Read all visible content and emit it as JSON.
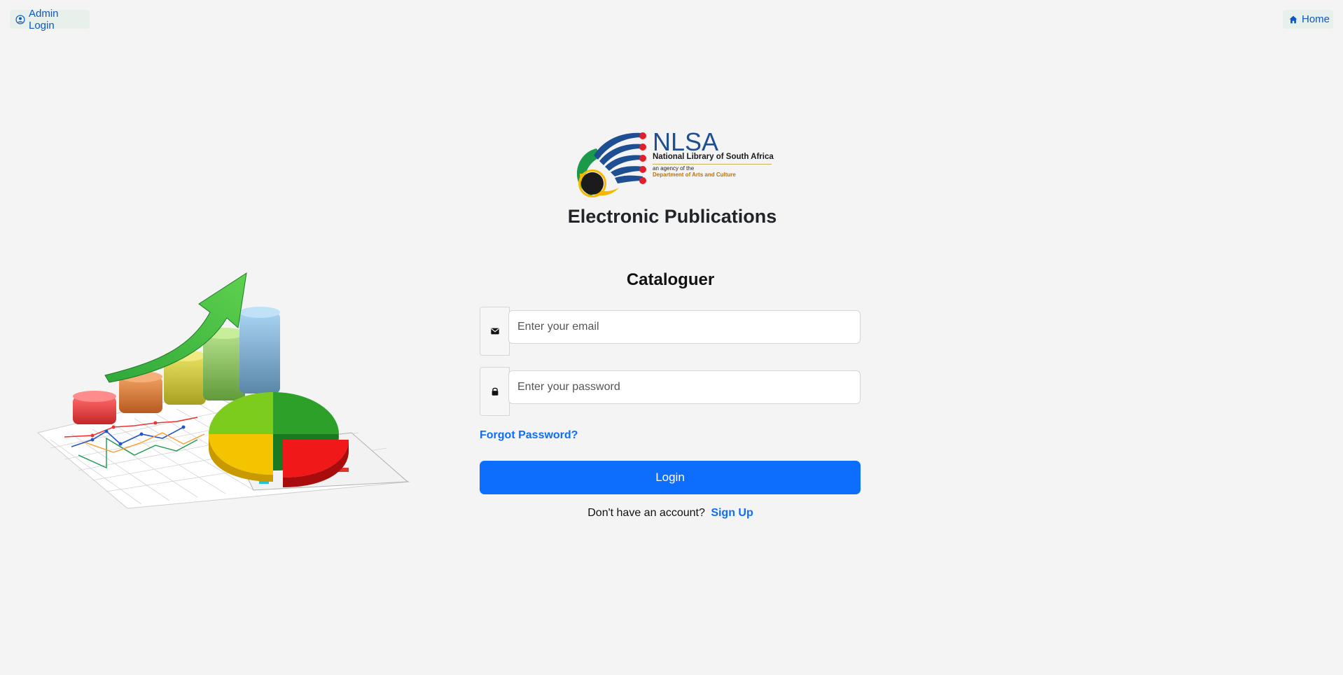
{
  "topbar": {
    "admin_login_label": "Admin Login",
    "home_label": "Home"
  },
  "logo": {
    "acronym": "NLSA",
    "full_name": "National Library of South Africa",
    "agency_line": "an agency of the",
    "department": "Department of Arts and Culture"
  },
  "app_title": "Electronic Publications",
  "form": {
    "title": "Cataloguer",
    "email_placeholder": "Enter your email",
    "email_value": "",
    "password_placeholder": "Enter your password",
    "password_value": "",
    "forgot_label": "Forgot Password?",
    "login_label": "Login",
    "no_account_text": "Don't have an account?",
    "signup_label": "Sign Up"
  },
  "icons": {
    "admin": "user-circle-icon",
    "home": "home-icon",
    "email": "envelope-icon",
    "password": "lock-icon"
  },
  "colors": {
    "background": "#f4f4f4",
    "primary": "#0d6efd",
    "link": "#0d6efd",
    "top_button_bg": "#e7f0ea",
    "top_button_text": "#0d58c7",
    "logo_blue": "#1f4f93",
    "logo_red": "#e0202a",
    "logo_green": "#1a9a4a",
    "logo_yellow": "#f5b800"
  }
}
